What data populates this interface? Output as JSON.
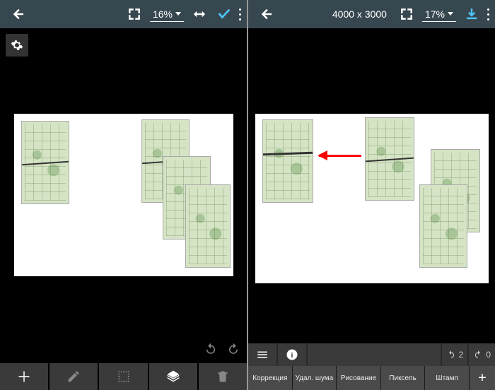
{
  "left": {
    "zoom": "16%",
    "toolbar_icons": {
      "back": "back",
      "fullscreen": "fullscreen",
      "swap": "swap",
      "confirm": "confirm",
      "more": "more"
    }
  },
  "right": {
    "dimensions": "4000 x 3000",
    "zoom": "17%",
    "undo_count": "2",
    "redo_count": "0",
    "tools": {
      "correction": "Коррекция",
      "noise": "Удал. шума",
      "draw": "Рисование",
      "pixel": "Пиксель",
      "stamp": "Штамп",
      "plus": "+"
    }
  }
}
